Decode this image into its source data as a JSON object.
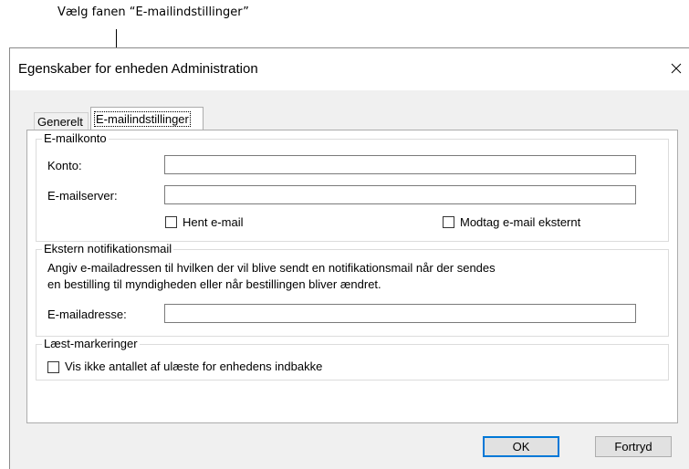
{
  "annotation": {
    "text": "Vælg fanen “E-mailindstillinger”"
  },
  "window": {
    "title": "Egenskaber for enheden Administration",
    "close_icon": "close-icon"
  },
  "tabs": [
    {
      "label": "Generelt",
      "selected": false
    },
    {
      "label": "E-mailindstillinger",
      "selected": true
    }
  ],
  "email_account": {
    "legend": "E-mailkonto",
    "account_label": "Konto:",
    "account_value": "",
    "server_label": "E-mailserver:",
    "server_value": "",
    "fetch_mail_label": "Hent e-mail",
    "fetch_mail_checked": false,
    "receive_external_label": "Modtag e-mail eksternt",
    "receive_external_checked": false
  },
  "external_notification": {
    "legend": "Ekstern notifikationsmail",
    "description_line1": "Angiv e-mailadressen til hvilken der vil blive sendt en notifikationsmail når der sendes",
    "description_line2": "en bestilling til myndigheden eller når bestillingen bliver ændret.",
    "address_label": "E-mailadresse:",
    "address_value": ""
  },
  "read_markings": {
    "legend": "Læst-markeringer",
    "hide_unread_label": "Vis ikke antallet af ulæste for enhedens indbakke",
    "hide_unread_checked": false
  },
  "buttons": {
    "ok": "OK",
    "cancel": "Fortryd"
  },
  "colors": {
    "default_button_border": "#0078d7",
    "dialog_background": "#f0f0f0"
  }
}
